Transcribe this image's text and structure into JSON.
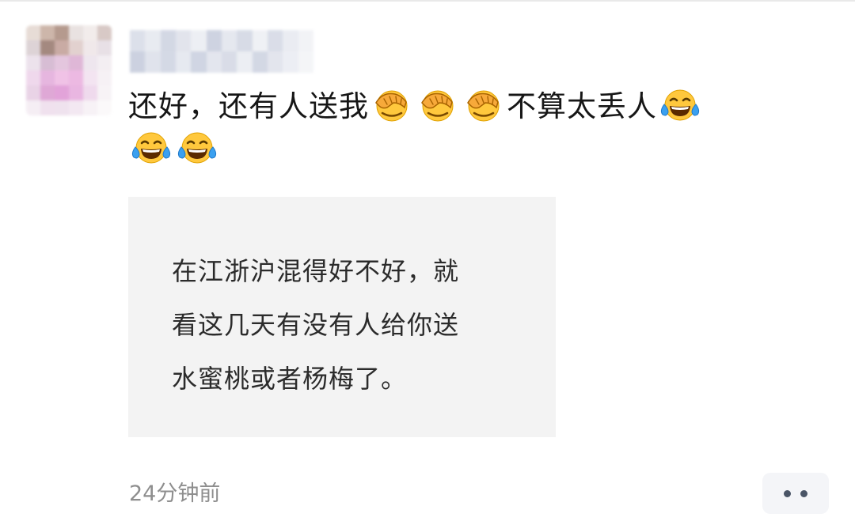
{
  "comment": {
    "avatar": {
      "kind": "pixelated-avatar",
      "colors": [
        "#e7dcd6",
        "#cdb6aa",
        "#b59a8e",
        "#e9e2e1",
        "#f2eceb",
        "#d8c9c6",
        "#ddd3d6",
        "#a48980",
        "#c9aba4",
        "#e2d1cf",
        "#f0e8ea",
        "#e8e0e6",
        "#ece2ec",
        "#d7bdd4",
        "#e4c6de",
        "#dfb7d7",
        "#eee6ee",
        "#f3eef2",
        "#efd8ec",
        "#e6b6df",
        "#f0c2e6",
        "#ecb9e2",
        "#f3e4f1",
        "#f6f1f5",
        "#e9d3e6",
        "#dfa8d6",
        "#e2a3d9",
        "#e9b6e1",
        "#efdaed",
        "#f7f3f6",
        "#f5eef4",
        "#f0e1ee",
        "#efe2ee",
        "#f3e8f2",
        "#f7f2f6",
        "#fbf9fa"
      ]
    },
    "username": {
      "kind": "pixelated-username",
      "colors": [
        "#d9dde8",
        "#e6e9f0",
        "#cfd4e2",
        "#dfe2eb",
        "#eceef3",
        "#c9cfde",
        "#e3e6ee",
        "#d3d8e4",
        "#eef0f4",
        "#d6dae6",
        "#e8ebf1",
        "#f1f2f6",
        "#c7cddd",
        "#dde1ea",
        "#d0d5e3",
        "#e4e7ef",
        "#cbd1e0",
        "#e1e4ed",
        "#d5d9e5",
        "#eaedf2",
        "#cfd4e2",
        "#e0e3ec",
        "#ebedf3",
        "#f3f4f7"
      ]
    },
    "content": [
      {
        "type": "text",
        "value": "还好，还有人送我"
      },
      {
        "type": "emoji",
        "icon": "face-palm-emoji"
      },
      {
        "type": "emoji",
        "icon": "face-palm-emoji"
      },
      {
        "type": "emoji",
        "icon": "face-palm-emoji"
      },
      {
        "type": "text",
        "value": "不算太丢人"
      },
      {
        "type": "emoji",
        "icon": "tears-of-joy-emoji"
      },
      {
        "type": "break"
      },
      {
        "type": "emoji",
        "icon": "tears-of-joy-emoji"
      },
      {
        "type": "emoji",
        "icon": "tears-of-joy-emoji"
      }
    ],
    "quoted_post": {
      "lines": [
        "在江浙沪混得好不好，就",
        "看这几天有没有人给你送",
        "水蜜桃或者杨梅了。"
      ]
    },
    "timestamp": "24分钟前",
    "more_icon": "more-dots-icon"
  }
}
